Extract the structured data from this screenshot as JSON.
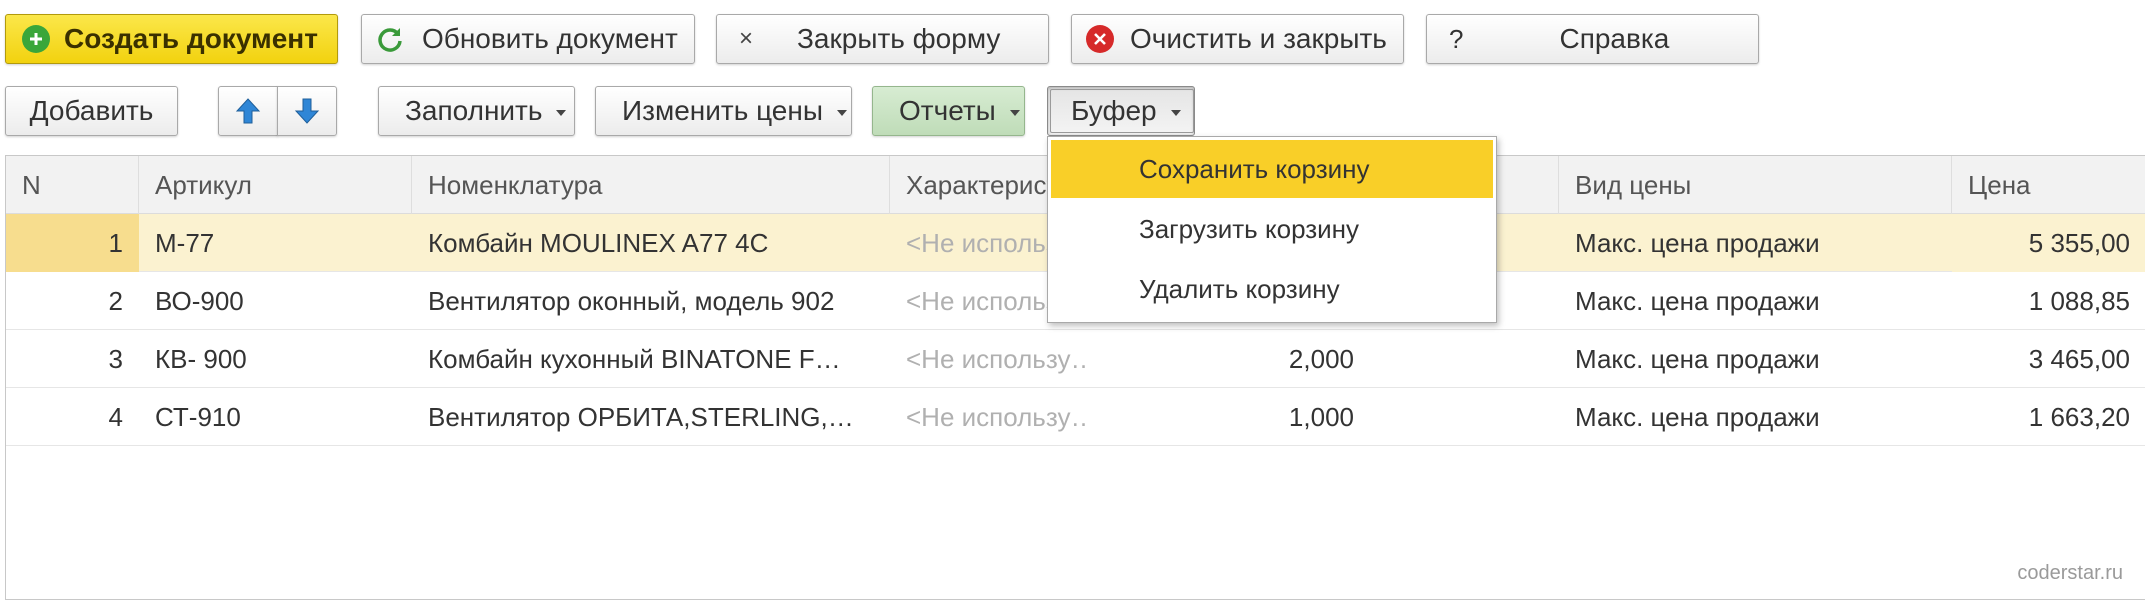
{
  "toolbar_top": {
    "create": "Создать документ",
    "refresh": "Обновить документ",
    "close_symbol": "×",
    "close": "Закрыть форму",
    "clear_close": "Очистить и закрыть",
    "help_symbol": "?",
    "help": "Справка"
  },
  "toolbar_table": {
    "add": "Добавить",
    "fill": "Заполнить",
    "change_prices": "Изменить цены",
    "reports": "Отчеты",
    "buffer": "Буфер"
  },
  "table": {
    "columns": [
      "N",
      "Артикул",
      "Номенклатура",
      "Характеристика",
      "Вид цены",
      "Цена"
    ],
    "rows": [
      {
        "n": "1",
        "article": "М-77",
        "name": "Комбайн MOULINEX  A77 4C",
        "char": "<Не используется>",
        "qty": "",
        "price_type": "Макс. цена продажи",
        "price": "5 355,00"
      },
      {
        "n": "2",
        "article": "ВО-900",
        "name": "Вентилятор оконный, модель 902",
        "char": "<Не используется>",
        "qty": "",
        "price_type": "Макс. цена продажи",
        "price": "1 088,85"
      },
      {
        "n": "3",
        "article": "КВ- 900",
        "name": "Комбайн кухонный BINATONE F…",
        "char": "<Не использу…",
        "qty": "2,000",
        "price_type": "Макс. цена продажи",
        "price": "3 465,00"
      },
      {
        "n": "4",
        "article": "СТ-910",
        "name": "Вентилятор ОРБИТА,STERLING,…",
        "char": "<Не использу…",
        "qty": "1,000",
        "price_type": "Макс. цена продажи",
        "price": "1 663,20"
      }
    ]
  },
  "buffer_menu": {
    "items": [
      "Сохранить корзину",
      "Загрузить корзину",
      "Удалить корзину"
    ]
  },
  "watermark": "coderstar.ru",
  "colors": {
    "primary": "#f2d20f",
    "menu_active": "#f9cf28",
    "row_selected": "#fbf2d0",
    "reports_green": "#c9e4c2",
    "refresh_icon": "#3a9a3a",
    "clear_icon": "#d62a2a",
    "arrow_icon": "#2f86d6"
  }
}
